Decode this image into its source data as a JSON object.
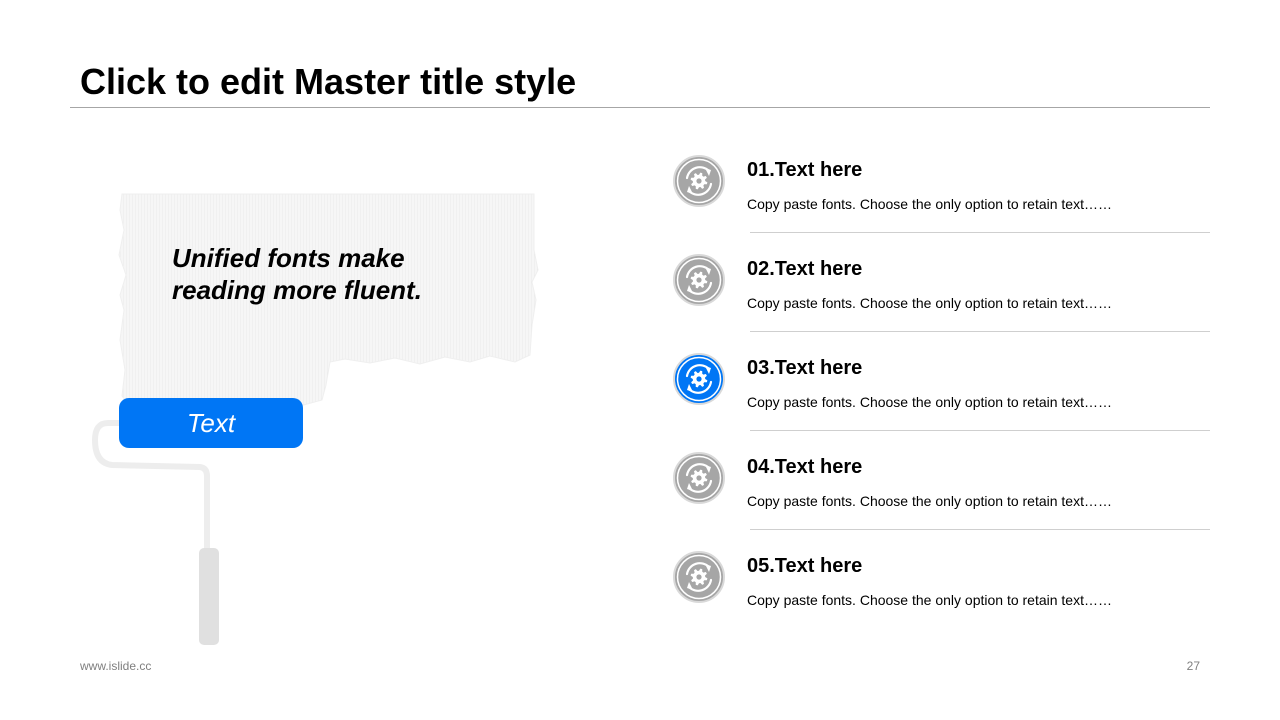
{
  "slide": {
    "title": "Click to edit Master title style",
    "quote_line1": "Unified fonts make",
    "quote_line2": "reading more fluent.",
    "button_label": "Text"
  },
  "items": [
    {
      "number": "01.",
      "heading": "01.Text here",
      "desc": "Copy paste fonts. Choose the only option to retain text……",
      "active": false,
      "icon": "gear-cycle-icon"
    },
    {
      "number": "02.",
      "heading": "02.Text here",
      "desc": "Copy paste fonts. Choose the only option to retain text……",
      "active": false,
      "icon": "gear-cycle-icon"
    },
    {
      "number": "03.",
      "heading": "03.Text here",
      "desc": "Copy paste fonts. Choose the only option to retain text……",
      "active": true,
      "icon": "gear-cycle-icon"
    },
    {
      "number": "04.",
      "heading": "04.Text here",
      "desc": "Copy paste fonts. Choose the only option to retain text……",
      "active": false,
      "icon": "gear-cycle-icon"
    },
    {
      "number": "05.",
      "heading": "05.Text here",
      "desc": "Copy paste fonts. Choose the only option to retain text……",
      "active": false,
      "icon": "gear-cycle-icon"
    }
  ],
  "footer": {
    "url": "www.islide.cc",
    "page": "27"
  },
  "colors": {
    "accent": "#0076f5",
    "icon_inactive": "#a6a6a6",
    "paint": "#f2f2f2",
    "roller_handle": "#e0e0e0"
  }
}
